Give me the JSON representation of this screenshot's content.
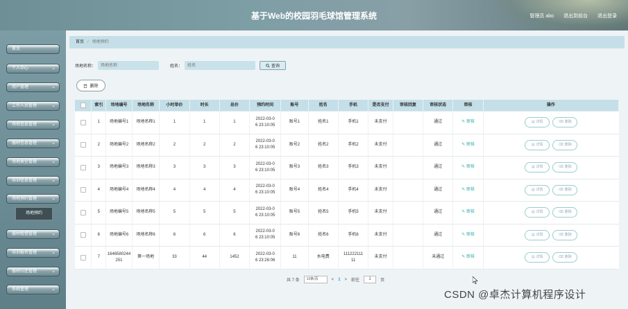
{
  "header": {
    "title": "基于Web的校园羽毛球馆管理系统",
    "user": "管理员 abo",
    "switch_label": "退出到前台",
    "logout_label": "退出登录"
  },
  "sidebar": {
    "items": [
      {
        "label": "首页"
      },
      {
        "label": "个人中心"
      },
      {
        "label": "用户管理"
      },
      {
        "label": "工作人员管理"
      },
      {
        "label": "场地信息管理"
      },
      {
        "label": "器材信息管理"
      },
      {
        "label": "场地类型管理"
      },
      {
        "label": "培训信息管理"
      },
      {
        "label": "场地预约管理"
      },
      {
        "label": "器材租借管理"
      },
      {
        "label": "培训报名管理"
      },
      {
        "label": "器材归还管理"
      },
      {
        "label": "系统管理"
      }
    ],
    "active_sub": "场地预约"
  },
  "breadcrumb": {
    "home": "首页",
    "current": "场地预约"
  },
  "search": {
    "field1_label": "场地名称",
    "field1_placeholder": "场地名称",
    "field2_label": "姓名",
    "field2_placeholder": "姓名",
    "button": "查询"
  },
  "delete_button": "删除",
  "table": {
    "headers": [
      "",
      "索引",
      "场地编号",
      "场地名称",
      "小时单价",
      "时长",
      "总价",
      "预约时间",
      "账号",
      "姓名",
      "手机",
      "是否支付",
      "审核回复",
      "审核状态",
      "审核",
      "操作"
    ],
    "rows": [
      [
        "1",
        "场地编号1",
        "场地名称1",
        "1",
        "1",
        "1",
        "2022-03-0\n6 23:10:05",
        "账号1",
        "姓名1",
        "手机1",
        "未支付",
        "",
        "通过"
      ],
      [
        "2",
        "场地编号2",
        "场地名称2",
        "2",
        "2",
        "2",
        "2022-03-0\n6 23:10:05",
        "账号2",
        "姓名2",
        "手机2",
        "未支付",
        "",
        "通过"
      ],
      [
        "3",
        "场地编号3",
        "场地名称3",
        "3",
        "3",
        "3",
        "2022-03-0\n6 23:10:05",
        "账号3",
        "姓名3",
        "手机3",
        "未支付",
        "",
        "通过"
      ],
      [
        "4",
        "场地编号4",
        "场地名称4",
        "4",
        "4",
        "4",
        "2022-03-0\n6 23:10:05",
        "账号4",
        "姓名4",
        "手机4",
        "未支付",
        "",
        "通过"
      ],
      [
        "5",
        "场地编号5",
        "场地名称5",
        "5",
        "5",
        "5",
        "2022-03-0\n6 23:10:05",
        "账号5",
        "姓名5",
        "手机5",
        "未支付",
        "",
        "通过"
      ],
      [
        "6",
        "场地编号6",
        "场地名称6",
        "6",
        "6",
        "6",
        "2022-03-0\n6 23:10:05",
        "账号6",
        "姓名6",
        "手机6",
        "未支付",
        "",
        "通过"
      ],
      [
        "7",
        "1646580244\n251",
        "第一场地",
        "33",
        "44",
        "1452",
        "2022-03-0\n6 23:26:06",
        "11",
        "水电费",
        "111222111\n11",
        "未支付",
        "",
        "未通过"
      ]
    ],
    "audit_label": "审核",
    "detail_label": "详情",
    "delete_label": "删除"
  },
  "pager": {
    "total": "共 7 条",
    "page_size": "10条/页",
    "prev": "<",
    "current": "1",
    "next": ">",
    "goto_label": "前往",
    "goto_value": "1",
    "page_unit": "页"
  },
  "watermark": "CSDN @卓杰计算机程序设计",
  "icons": [
    "search-icon",
    "trash-icon",
    "edit-icon",
    "chevron-down-icon",
    "cursor-icon"
  ]
}
